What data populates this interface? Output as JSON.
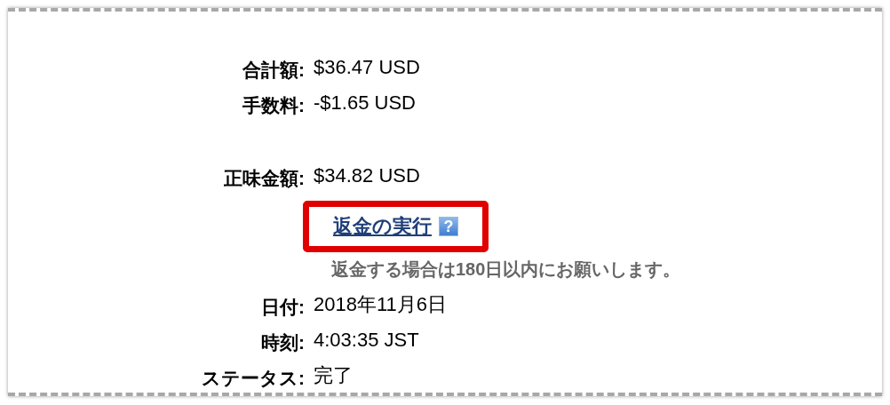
{
  "rows": [
    {
      "kind": "field",
      "label": "合計額:",
      "value": "$36.47 USD"
    },
    {
      "kind": "field",
      "label": "手数料:",
      "value": "-$1.65 USD"
    },
    {
      "kind": "total",
      "label": "正味金額:",
      "value": "$34.82 USD"
    },
    {
      "kind": "link",
      "text": "返金の実行",
      "help": "?",
      "highlighted": true
    },
    {
      "kind": "note",
      "text": "返金する場合は180日以内にお願いします。"
    },
    {
      "kind": "field",
      "label": "日付:",
      "value": "2018年11月6日"
    },
    {
      "kind": "field",
      "label": "時刻:",
      "value": "4:03:35 JST"
    },
    {
      "kind": "field",
      "label": "ステータス:",
      "value": "完了"
    }
  ]
}
